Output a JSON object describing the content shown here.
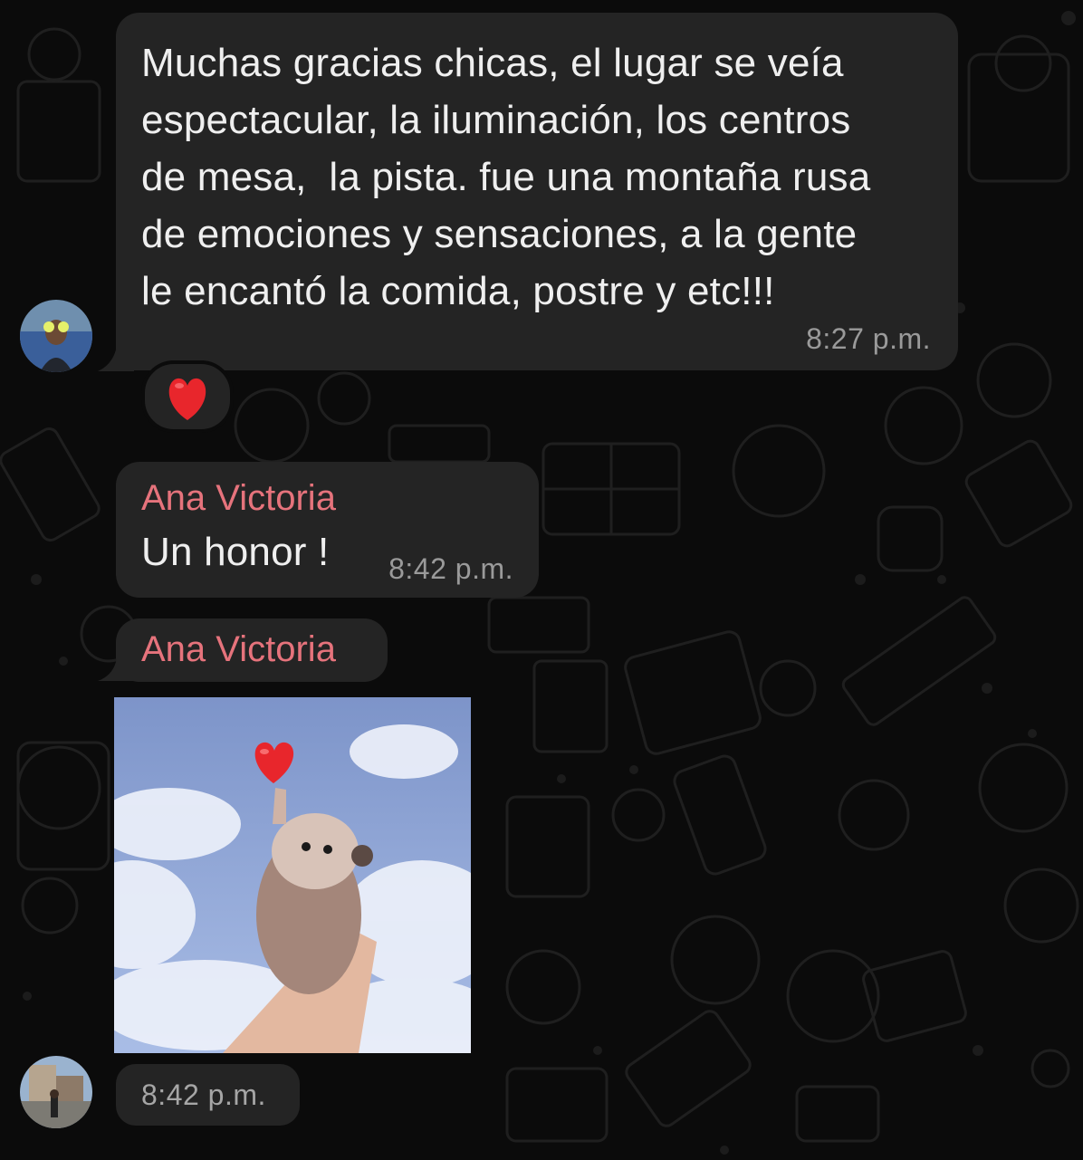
{
  "messages": [
    {
      "text_lines": [
        "Muchas gracias chicas, el lugar se veía",
        "espectacular, la iluminación, los centros",
        "de mesa,  la pista. fue una montaña rusa",
        "de emociones y sensaciones, a la gente",
        "le encantó la comida, postre y etc!!!"
      ],
      "time": "8:27 p.m.",
      "reaction": "❤️"
    },
    {
      "sender": "Ana Victoria",
      "text": "Un honor !",
      "time": "8:42 p.m."
    },
    {
      "sender": "Ana Victoria",
      "image_description": "hedgehog held up by a hand with a heart",
      "time": "8:42 p.m."
    }
  ],
  "colors": {
    "background": "#0b0b0b",
    "bubble": "#242424",
    "sender_name": "#e6737c",
    "timestamp": "#9a9a9a",
    "text": "#efefef"
  },
  "icons": [
    "heart-reaction-icon",
    "heart-icon"
  ]
}
